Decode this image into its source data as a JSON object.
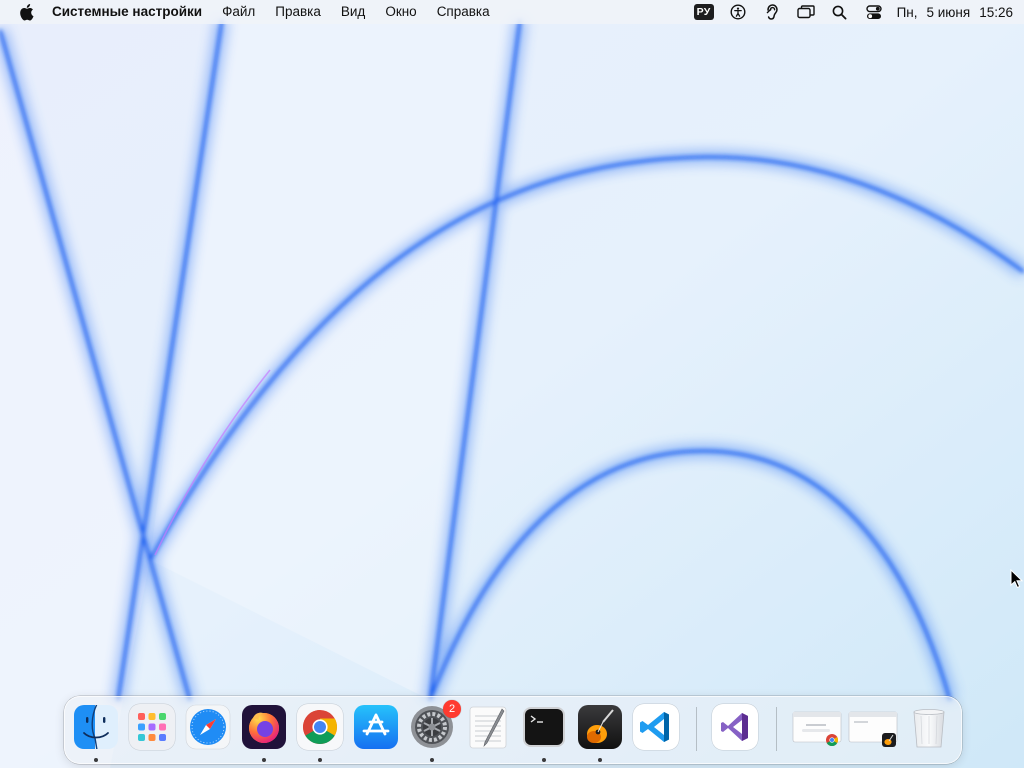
{
  "menubar": {
    "apple_icon": "apple-logo-icon",
    "app_name": "Системные настройки",
    "menus": [
      "Файл",
      "Правка",
      "Вид",
      "Окно",
      "Справка"
    ],
    "status": {
      "input_language": "РУ",
      "icons": [
        "accessibility-icon",
        "hearing-icon",
        "screen-mirroring-icon",
        "spotlight-search-icon",
        "control-center-icon"
      ],
      "day": "Пн,",
      "date": "5 июня",
      "time": "15:26"
    }
  },
  "dock": {
    "apps": [
      {
        "name": "Finder",
        "icon": "finder-icon",
        "running": true
      },
      {
        "name": "Launchpad",
        "icon": "launchpad-icon",
        "running": false
      },
      {
        "name": "Safari",
        "icon": "safari-icon",
        "running": false
      },
      {
        "name": "Firefox",
        "icon": "firefox-icon",
        "running": true
      },
      {
        "name": "Google Chrome",
        "icon": "chrome-icon",
        "running": true
      },
      {
        "name": "App Store",
        "icon": "app-store-icon",
        "running": false
      },
      {
        "name": "System Preferences",
        "icon": "system-preferences-icon",
        "running": true,
        "badge": "2"
      },
      {
        "name": "TextEdit",
        "icon": "textedit-icon",
        "running": false
      },
      {
        "name": "Terminal",
        "icon": "terminal-icon",
        "running": true
      },
      {
        "name": "GarageBand",
        "icon": "garageband-icon",
        "running": true
      },
      {
        "name": "Visual Studio Code",
        "icon": "vscode-icon",
        "running": false
      },
      {
        "name": "Visual Studio",
        "icon": "visual-studio-icon",
        "running": false
      }
    ],
    "recent": [
      {
        "name": "Chrome window",
        "icon": "chrome-window-thumbnail"
      },
      {
        "name": "GarageBand window",
        "icon": "garageband-window-thumbnail"
      }
    ],
    "trash": {
      "name": "Trash",
      "icon": "trash-icon",
      "empty": true
    }
  },
  "colors": {
    "wallpaper_base": "#e4f0fb",
    "wallpaper_line": "#2a6cf0",
    "menubar_bg": "#f0f3f8",
    "badge": "#ff3b30"
  }
}
